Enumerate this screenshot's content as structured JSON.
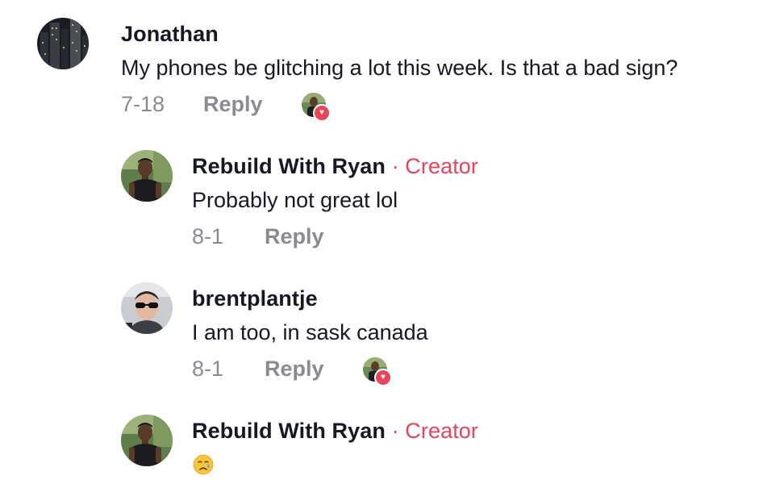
{
  "comments": [
    {
      "author": "Jonathan",
      "text": "My phones be glitching a lot this week. Is that a bad sign?",
      "date": "7-18",
      "reply_label": "Reply",
      "liked_by_creator": true
    },
    {
      "author": "Rebuild With Ryan",
      "badge_separator": "·",
      "badge": "Creator",
      "text": "Probably not great lol",
      "date": "8-1",
      "reply_label": "Reply",
      "liked_by_creator": false
    },
    {
      "author": "brentplantje",
      "text": "I am too, in sask canada",
      "date": "8-1",
      "reply_label": "Reply",
      "liked_by_creator": true
    },
    {
      "author": "Rebuild With Ryan",
      "badge_separator": "·",
      "badge": "Creator",
      "text_emoji": "crying-face-emoji"
    }
  ],
  "colors": {
    "creator_accent": "#e8445a",
    "meta_gray": "#8a8b91",
    "text_primary": "#161823"
  },
  "icons": {
    "creator_like": "heart-icon"
  }
}
